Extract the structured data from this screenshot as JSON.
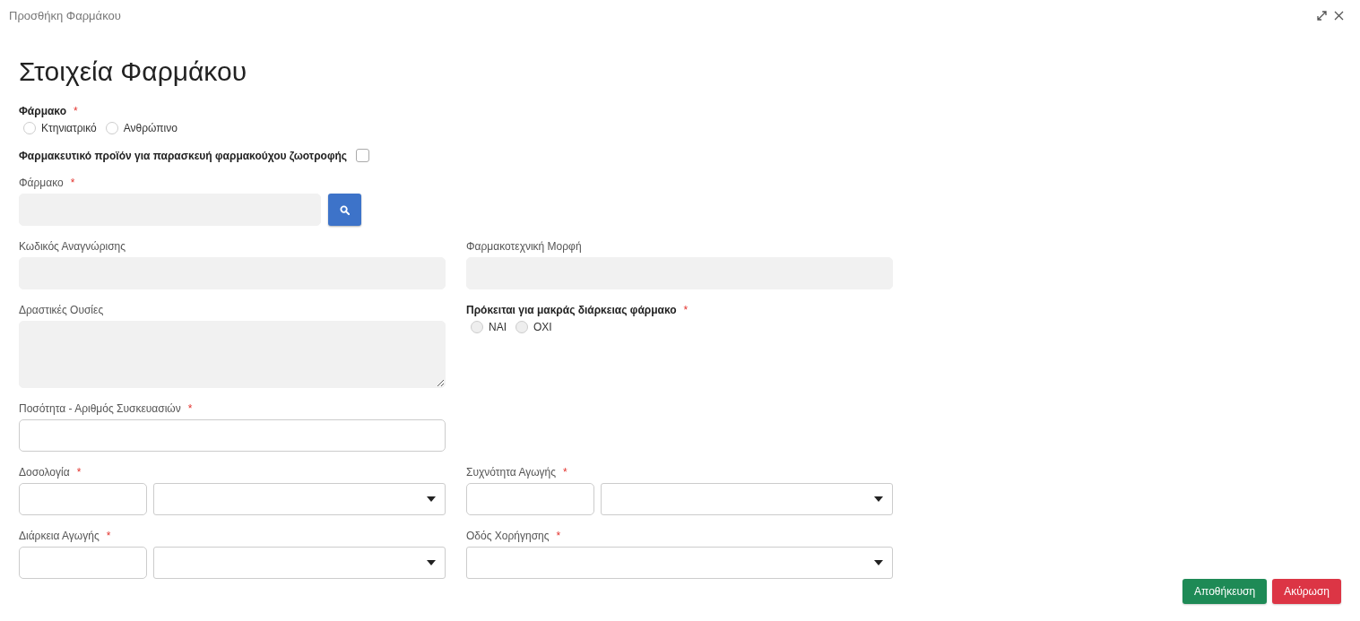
{
  "window": {
    "title": "Προσθήκη Φαρμάκου"
  },
  "heading": "Στοιχεία Φαρμάκου",
  "rows": [
    [
      {
        "kind": "radio_group",
        "label": "Φάρμακο",
        "required_mark": "*",
        "disabled": false,
        "options": [
          {
            "label": "Κτηνιατρικό",
            "selected": false
          },
          {
            "label": "Ανθρώπινο",
            "selected": false
          }
        ]
      }
    ],
    [
      {
        "kind": "checkbox",
        "label": "Φαρμακευτικό προϊόν για παρασκευή φαρμακούχου ζωοτροφής",
        "checked": false
      }
    ],
    [
      {
        "kind": "lookup",
        "label": "Φάρμακο",
        "required_mark": "*",
        "disabled": true
      }
    ],
    [
      {
        "kind": "text",
        "label": "Κωδικός Αναγνώρισης",
        "disabled": true
      },
      {
        "kind": "text",
        "label": "Φαρμακοτεχνική Μορφή",
        "disabled": true
      }
    ],
    [
      {
        "kind": "textarea",
        "label": "Δραστικές Ουσίες",
        "disabled": true
      },
      {
        "kind": "radio_group",
        "label": "Πρόκειται για μακράς διάρκειας φάρμακο",
        "required_mark": "*",
        "disabled": true,
        "options": [
          {
            "label": "NAI",
            "selected": false
          },
          {
            "label": "OXI",
            "selected": false
          }
        ]
      }
    ],
    [
      {
        "kind": "text",
        "label": "Ποσότητα - Αριθμός Συσκευασιών",
        "required_mark": "*",
        "disabled": false
      }
    ],
    [
      {
        "kind": "split_select",
        "label": "Δοσολογία",
        "required_mark": "*"
      },
      {
        "kind": "split_select",
        "label": "Συχνότητα Αγωγής",
        "required_mark": "*"
      }
    ],
    [
      {
        "kind": "split_select",
        "label": "Διάρκεια Αγωγής",
        "required_mark": "*"
      },
      {
        "kind": "select",
        "label": "Οδός Χορήγησης",
        "required_mark": "*"
      }
    ]
  ],
  "buttons": [
    {
      "label": "Αποθήκευση",
      "kind": "primary"
    },
    {
      "label": "Ακύρωση",
      "kind": "danger"
    }
  ]
}
